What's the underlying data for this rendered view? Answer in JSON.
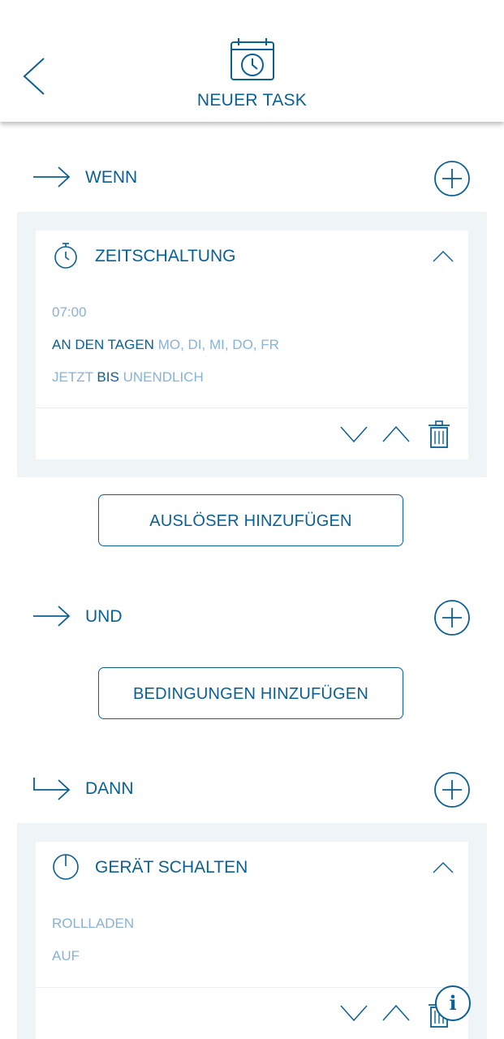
{
  "header": {
    "title": "NEUER TASK",
    "back_icon": "chevron-left-icon",
    "icon": "calendar-clock-icon"
  },
  "colors": {
    "primary": "#0a5f93",
    "muted": "#86b3d6",
    "panel": "#eff4f6"
  },
  "sections": {
    "wenn": {
      "label": "WENN",
      "arrow_icon": "arrow-right-icon",
      "add_icon": "plus-circle-icon"
    },
    "und": {
      "label": "UND",
      "arrow_icon": "arrow-right-icon",
      "add_icon": "plus-circle-icon"
    },
    "dann": {
      "label": "DANN",
      "arrow_icon": "arrow-turn-right-icon",
      "add_icon": "plus-circle-icon"
    }
  },
  "trigger_card": {
    "title": "ZEITSCHALTUNG",
    "icon": "stopwatch-icon",
    "time": "07:00",
    "days_label": "AN DEN TAGEN",
    "days_value": "MO, DI, MI, DO, FR",
    "range_from": "JETZT",
    "range_sep": "BIS",
    "range_to": "UNENDLICH"
  },
  "add_trigger_button": "AUSLÖSER HINZUFÜGEN",
  "add_condition_button": "BEDINGUNGEN HINZUFÜGEN",
  "action_card": {
    "title": "GERÄT SCHALTEN",
    "icon": "power-icon",
    "device": "ROLLLADEN",
    "state": "AUF"
  },
  "info_button": {
    "label": "i",
    "icon": "info-icon"
  }
}
